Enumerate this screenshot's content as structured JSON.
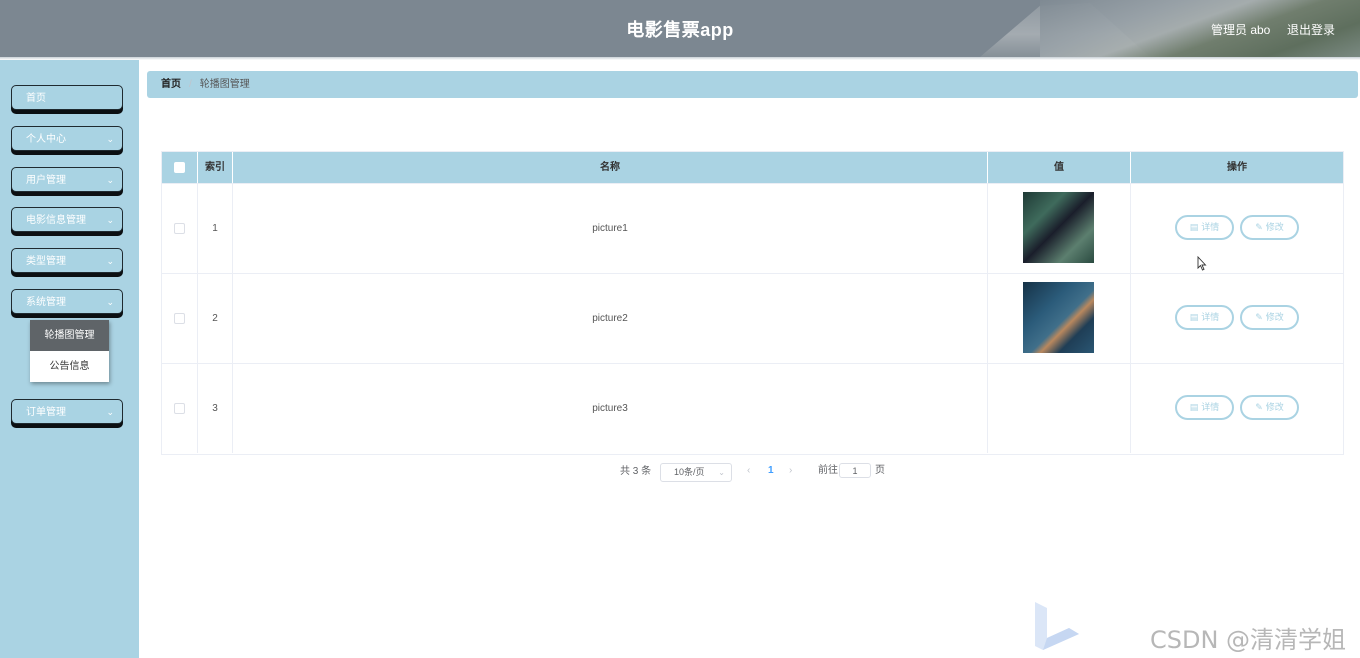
{
  "header": {
    "title": "电影售票app",
    "user_label": "管理员 abo",
    "logout_label": "退出登录"
  },
  "sidebar": {
    "items": [
      {
        "label": "首页",
        "has_children": false
      },
      {
        "label": "个人中心",
        "has_children": true
      },
      {
        "label": "用户管理",
        "has_children": true
      },
      {
        "label": "电影信息管理",
        "has_children": true
      },
      {
        "label": "类型管理",
        "has_children": true
      },
      {
        "label": "系统管理",
        "has_children": true,
        "expanded": true
      },
      {
        "label": "订单管理",
        "has_children": true
      }
    ],
    "submenu": [
      {
        "label": "轮播图管理",
        "active": true
      },
      {
        "label": "公告信息",
        "active": false
      }
    ]
  },
  "breadcrumb": {
    "home": "首页",
    "separator": "/",
    "current": "轮播图管理"
  },
  "table": {
    "columns": [
      "索引",
      "名称",
      "值",
      "操作"
    ],
    "rows": [
      {
        "index": "1",
        "name": "picture1",
        "has_image": true
      },
      {
        "index": "2",
        "name": "picture2",
        "has_image": true
      },
      {
        "index": "3",
        "name": "picture3",
        "has_image": false
      }
    ],
    "detail_label": "详情",
    "edit_label": "修改"
  },
  "pagination": {
    "total": "共 3 条",
    "page_size": "10条/页",
    "current_page": "1",
    "goto_label": "前往",
    "goto_value": "1",
    "goto_suffix": "页"
  },
  "watermark": "CSDN @清清学姐",
  "colors": {
    "header_bg": "#7c8791",
    "sidebar_bg": "#aad3e3",
    "accent": "#aad3e3",
    "submenu_active": "#5f6468"
  },
  "icons": {
    "chevron": "chevron-down-icon",
    "detail": "document-icon",
    "edit": "pencil-icon",
    "prev": "chevron-left-icon",
    "next": "chevron-right-icon"
  }
}
